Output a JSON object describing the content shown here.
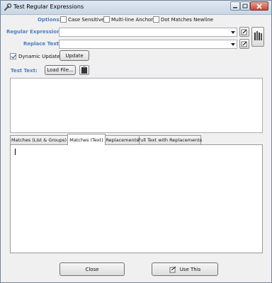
{
  "window": {
    "title": "Test Regular Expressions",
    "icon": "wrench-icon",
    "controls": [
      "minimize-icon",
      "maximize-icon",
      "close-icon"
    ]
  },
  "options": {
    "label": "Options:",
    "case_sensitive": {
      "label": "Case Sensitive",
      "checked": false
    },
    "multiline_anchors": {
      "label": "Multi-line Anchors",
      "checked": false
    },
    "dot_matches_newline": {
      "label": "Dot Matches Newline",
      "checked": false
    }
  },
  "regex": {
    "label": "Regular Expression:",
    "value": ""
  },
  "replace": {
    "label": "Replace Text:",
    "value": ""
  },
  "dynamic_update": {
    "label": "Dynamic Update",
    "checked": true
  },
  "update_button": "Update",
  "test_text": {
    "label": "Test Text:",
    "load_file_button": "Load File...",
    "value": ""
  },
  "tabs": [
    {
      "label": "Matches (List & Groups)",
      "active": false
    },
    {
      "label": "Matches (Text)",
      "active": true
    },
    {
      "label": "Replacements",
      "active": false
    },
    {
      "label": "Full Text with Replacements",
      "active": false
    }
  ],
  "footer": {
    "close_button": "Close",
    "use_this_button": "Use This"
  },
  "colors": {
    "label_blue": "#4a7fc1",
    "window_bg": "#f0f0f0"
  }
}
